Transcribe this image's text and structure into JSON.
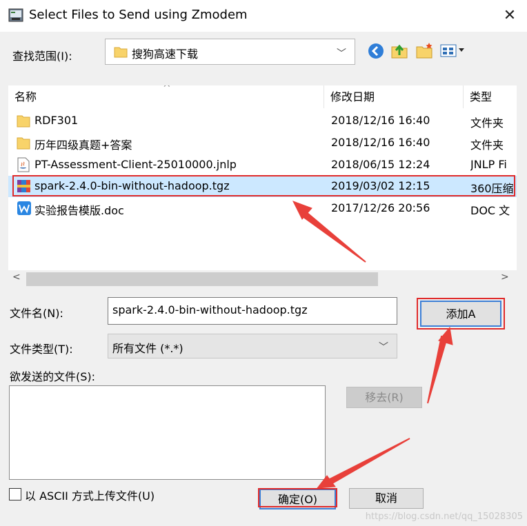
{
  "window": {
    "title": "Select Files to Send using Zmodem",
    "close_glyph": "✕"
  },
  "lookin": {
    "label": "查找范围(I):",
    "value": "搜狗高速下载"
  },
  "columns": [
    "名称",
    "修改日期",
    "类型"
  ],
  "files": [
    {
      "name": "RDF301",
      "date": "2018/12/16 16:40",
      "type": "文件夹",
      "icon": "folder-icon"
    },
    {
      "name": "历年四级真题+答案",
      "date": "2018/12/16 16:40",
      "type": "文件夹",
      "icon": "folder-icon"
    },
    {
      "name": "PT-Assessment-Client-25010000.jnlp",
      "date": "2018/06/15 12:24",
      "type": "JNLP Fi",
      "icon": "java-file-icon"
    },
    {
      "name": "spark-2.4.0-bin-without-hadoop.tgz",
      "date": "2019/03/02 12:15",
      "type": "360压缩",
      "icon": "archive-icon",
      "selected": true
    },
    {
      "name": "实验报告模版.doc",
      "date": "2017/12/26 20:56",
      "type": "DOC 文",
      "icon": "wps-doc-icon"
    }
  ],
  "filename": {
    "label": "文件名(N):",
    "value": "spark-2.4.0-bin-without-hadoop.tgz"
  },
  "filetype": {
    "label": "文件类型(T):",
    "value": "所有文件 (*.*)"
  },
  "send_list": {
    "label": "欲发送的文件(S):"
  },
  "buttons": {
    "add": "添加A",
    "remove": "移去(R)",
    "ok": "确定(O)",
    "cancel": "取消"
  },
  "ascii": {
    "label": "以 ASCII 方式上传文件(U)",
    "checked": false
  },
  "watermark": "https://blog.csdn.net/qq_15028305",
  "colors": {
    "selection": "#cce8ff",
    "annotation": "#e02a2a",
    "folder": "#f8d36a"
  }
}
